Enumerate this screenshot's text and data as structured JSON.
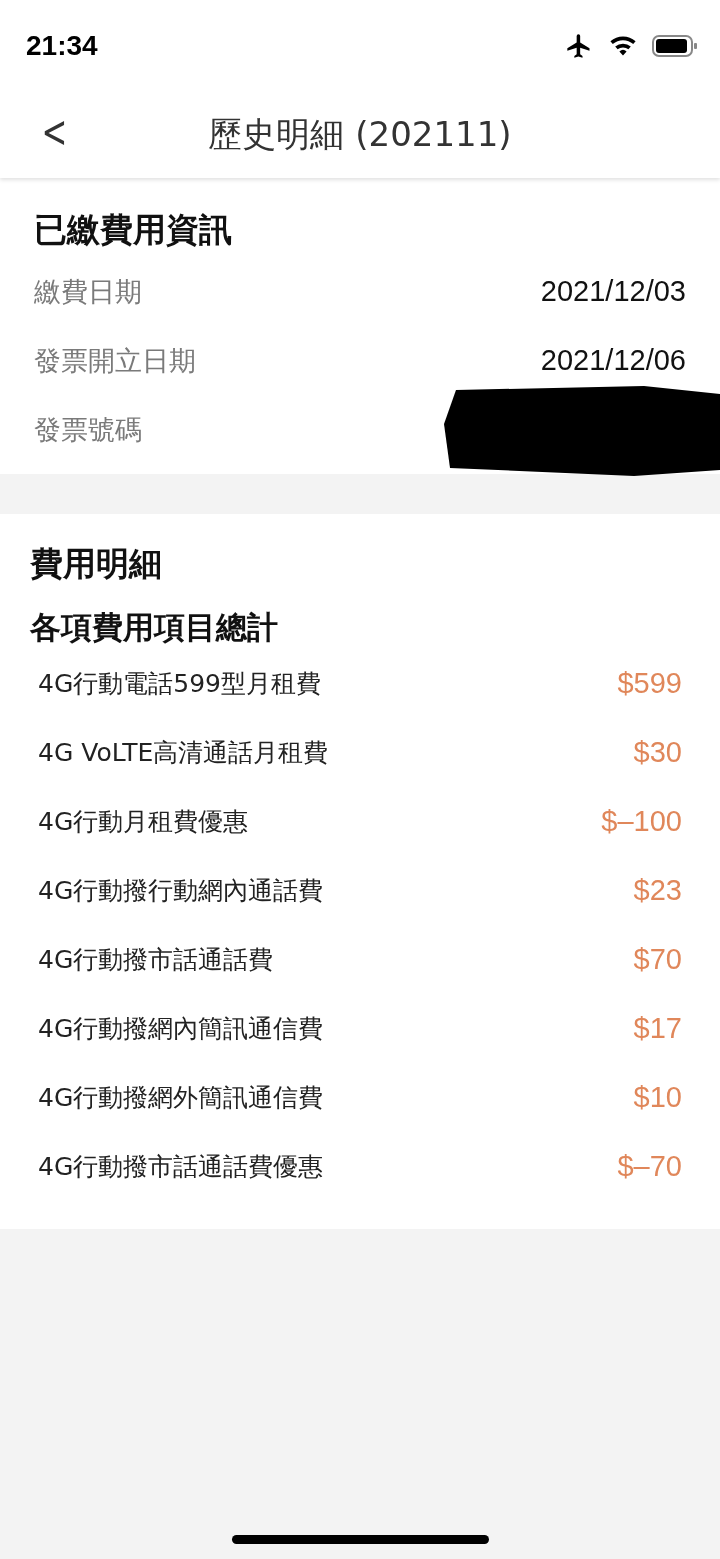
{
  "status_bar": {
    "time": "21:34"
  },
  "header": {
    "back": "<",
    "title": "歷史明細 (202111)"
  },
  "payment_info": {
    "title": "已繳費用資訊",
    "rows": [
      {
        "label": "繳費日期",
        "value": "2021/12/03",
        "redacted": false
      },
      {
        "label": "發票開立日期",
        "value": "2021/12/06",
        "redacted": false
      },
      {
        "label": "發票號碼",
        "redacted": true
      }
    ]
  },
  "fee_details": {
    "title": "費用明細",
    "subtitle": "各項費用項目總計",
    "items": [
      {
        "name": "4G行動電話599型月租費",
        "amount": "$599"
      },
      {
        "name": "4G VoLTE高清通話月租費",
        "amount": "$30"
      },
      {
        "name": "4G行動月租費優惠",
        "amount": "$–100"
      },
      {
        "name": "4G行動撥行動網內通話費",
        "amount": "$23"
      },
      {
        "name": "4G行動撥市話通話費",
        "amount": "$70"
      },
      {
        "name": "4G行動撥網內簡訊通信費",
        "amount": "$17"
      },
      {
        "name": "4G行動撥網外簡訊通信費",
        "amount": "$10"
      },
      {
        "name": "4G行動撥市話通話費優惠",
        "amount": "$–70"
      }
    ]
  }
}
